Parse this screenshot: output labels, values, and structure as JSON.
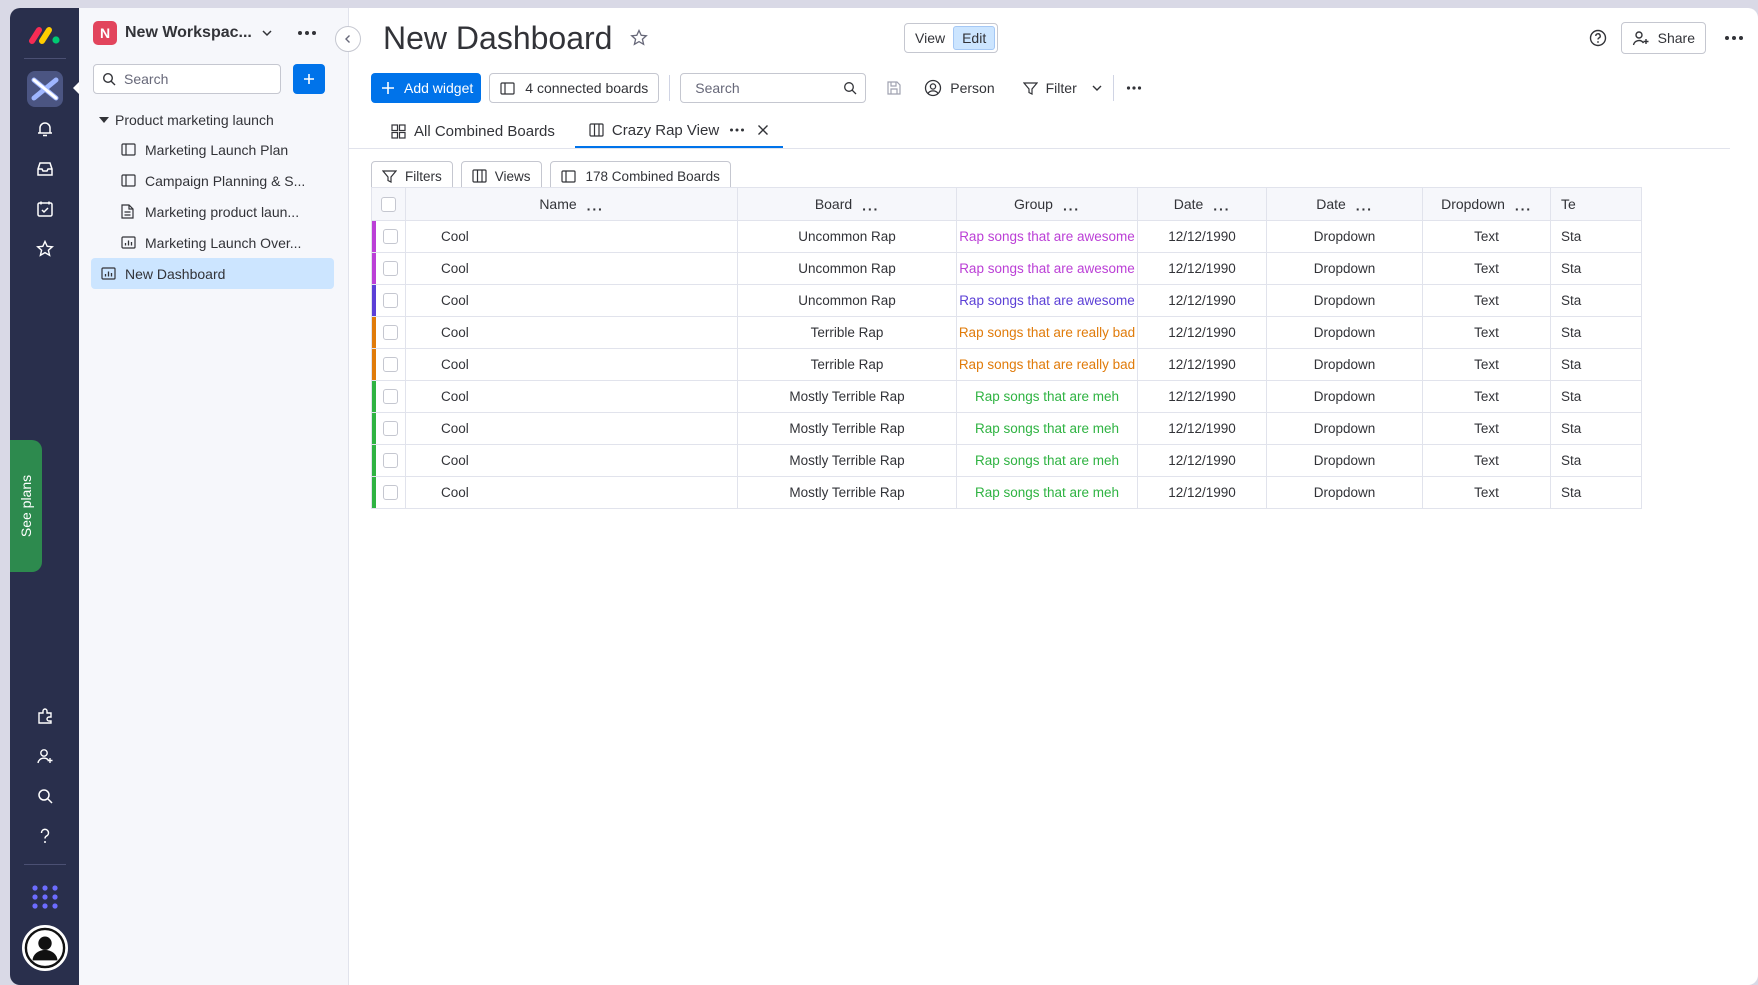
{
  "workspace": {
    "badge": "N",
    "name": "New Workspac..."
  },
  "sidebar": {
    "search_placeholder": "Search",
    "folder": "Product marketing launch",
    "items": [
      {
        "label": "Marketing Launch Plan",
        "icon": "board-icon"
      },
      {
        "label": "Campaign Planning & S...",
        "icon": "board-icon"
      },
      {
        "label": "Marketing product laun...",
        "icon": "doc-icon"
      },
      {
        "label": "Marketing Launch Over...",
        "icon": "dashboard-icon"
      },
      {
        "label": "New Dashboard",
        "icon": "dashboard-icon",
        "active": true
      }
    ]
  },
  "rail": {
    "see_plans": "See plans"
  },
  "header": {
    "title": "New Dashboard",
    "view_label": "View",
    "edit_label": "Edit",
    "share_label": "Share"
  },
  "toolbar": {
    "add_widget": "Add widget",
    "connected_boards": "4 connected boards",
    "search_placeholder": "Search",
    "person": "Person",
    "filter": "Filter"
  },
  "tabs": [
    {
      "label": "All Combined Boards"
    },
    {
      "label": "Crazy Rap View",
      "active": true
    }
  ],
  "filters": {
    "filters_label": "Filters",
    "views_label": "Views",
    "combined_label": "178 Combined Boards"
  },
  "table": {
    "columns": [
      "Name",
      "Board",
      "Group",
      "Date",
      "Date",
      "Dropdown",
      "Te"
    ],
    "rows": [
      {
        "name": "Cool",
        "board": "Uncommon Rap",
        "group": "Rap songs that are awesome",
        "date1": "12/12/1990",
        "date2": "Dropdown",
        "dropdown": "Text",
        "last": "Sta",
        "color": "#bb3fd6"
      },
      {
        "name": "Cool",
        "board": "Uncommon Rap",
        "group": "Rap songs that are awesome",
        "date1": "12/12/1990",
        "date2": "Dropdown",
        "dropdown": "Text",
        "last": "Sta",
        "color": "#bb3fd6"
      },
      {
        "name": "Cool",
        "board": "Uncommon Rap",
        "group": "Rap songs that are awesome",
        "date1": "12/12/1990",
        "date2": "Dropdown",
        "dropdown": "Text",
        "last": "Sta",
        "color": "#5b3fd6"
      },
      {
        "name": "Cool",
        "board": "Terrible Rap",
        "group": "Rap songs that are really bad",
        "date1": "12/12/1990",
        "date2": "Dropdown",
        "dropdown": "Text",
        "last": "Sta",
        "color": "#e07b0a"
      },
      {
        "name": "Cool",
        "board": "Terrible Rap",
        "group": "Rap songs that are really bad",
        "date1": "12/12/1990",
        "date2": "Dropdown",
        "dropdown": "Text",
        "last": "Sta",
        "color": "#e07b0a"
      },
      {
        "name": "Cool",
        "board": "Mostly Terrible Rap",
        "group": "Rap songs that are meh",
        "date1": "12/12/1990",
        "date2": "Dropdown",
        "dropdown": "Text",
        "last": "Sta",
        "color": "#2fb342"
      },
      {
        "name": "Cool",
        "board": "Mostly Terrible Rap",
        "group": "Rap songs that are meh",
        "date1": "12/12/1990",
        "date2": "Dropdown",
        "dropdown": "Text",
        "last": "Sta",
        "color": "#2fb342"
      },
      {
        "name": "Cool",
        "board": "Mostly Terrible Rap",
        "group": "Rap songs that are meh",
        "date1": "12/12/1990",
        "date2": "Dropdown",
        "dropdown": "Text",
        "last": "Sta",
        "color": "#2fb342"
      },
      {
        "name": "Cool",
        "board": "Mostly Terrible Rap",
        "group": "Rap songs that are meh",
        "date1": "12/12/1990",
        "date2": "Dropdown",
        "dropdown": "Text",
        "last": "Sta",
        "color": "#2fb342"
      }
    ]
  }
}
